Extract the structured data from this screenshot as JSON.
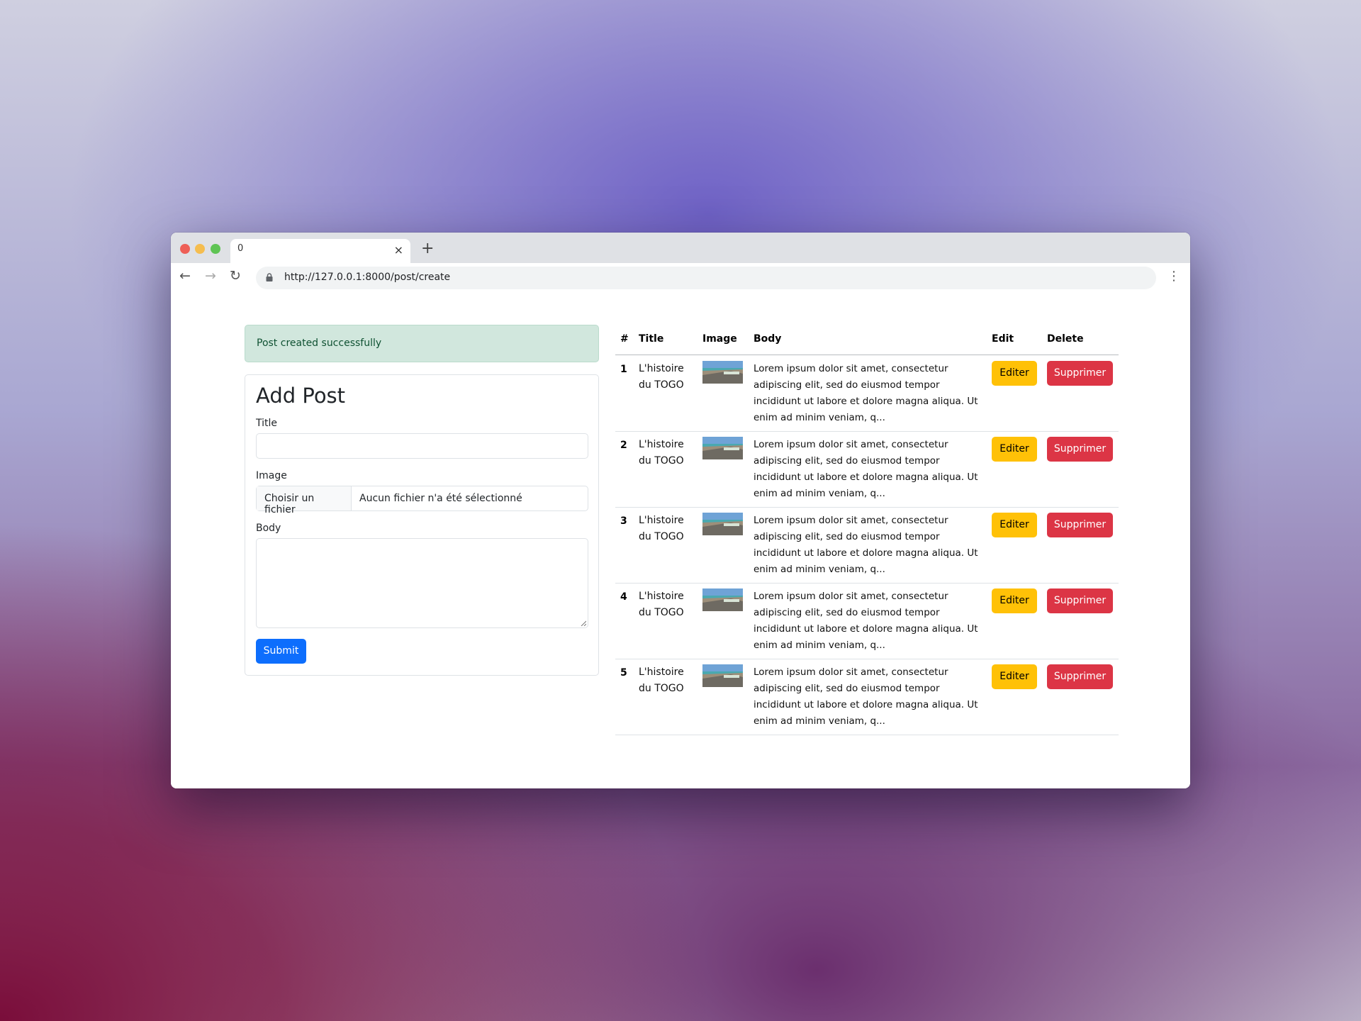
{
  "browser": {
    "tab_title": "0",
    "tab_close": "×",
    "new_tab": "+",
    "url": "http://127.0.0.1:8000/post/create",
    "nav_back": "←",
    "nav_forward": "→",
    "nav_reload": "↻",
    "menu": "⋮"
  },
  "alert": {
    "message": "Post created successfully"
  },
  "form": {
    "heading": "Add Post",
    "title_label": "Title",
    "title_value": "",
    "image_label": "Image",
    "file_button": "Choisir un fichier",
    "file_status": "Aucun fichier n'a été sélectionné",
    "body_label": "Body",
    "body_value": "",
    "submit_label": "Submit"
  },
  "table": {
    "headers": [
      "#",
      "Title",
      "Image",
      "Body",
      "Edit",
      "Delete"
    ],
    "rows": [
      {
        "num": "1",
        "title": "L'histoire du TOGO",
        "body": "Lorem ipsum dolor sit amet, consectetur adipiscing elit, sed do eiusmod tempor incididunt ut labore et dolore magna aliqua. Ut enim ad minim veniam, q...",
        "edit": "Editer",
        "delete": "Supprimer"
      },
      {
        "num": "2",
        "title": "L'histoire du TOGO",
        "body": "Lorem ipsum dolor sit amet, consectetur adipiscing elit, sed do eiusmod tempor incididunt ut labore et dolore magna aliqua. Ut enim ad minim veniam, q...",
        "edit": "Editer",
        "delete": "Supprimer"
      },
      {
        "num": "3",
        "title": "L'histoire du TOGO",
        "body": "Lorem ipsum dolor sit amet, consectetur adipiscing elit, sed do eiusmod tempor incididunt ut labore et dolore magna aliqua. Ut enim ad minim veniam, q...",
        "edit": "Editer",
        "delete": "Supprimer"
      },
      {
        "num": "4",
        "title": "L'histoire du TOGO",
        "body": "Lorem ipsum dolor sit amet, consectetur adipiscing elit, sed do eiusmod tempor incididunt ut labore et dolore magna aliqua. Ut enim ad minim veniam, q...",
        "edit": "Editer",
        "delete": "Supprimer"
      },
      {
        "num": "5",
        "title": "L'histoire du TOGO",
        "body": "Lorem ipsum dolor sit amet, consectetur adipiscing elit, sed do eiusmod tempor incididunt ut labore et dolore magna aliqua. Ut enim ad minim veniam, q...",
        "edit": "Editer",
        "delete": "Supprimer"
      }
    ]
  },
  "colors": {
    "primary": "#0d6efd",
    "warning": "#ffc107",
    "danger": "#dc3545",
    "success_bg": "#d1e7dd",
    "success_text": "#0f5132"
  }
}
